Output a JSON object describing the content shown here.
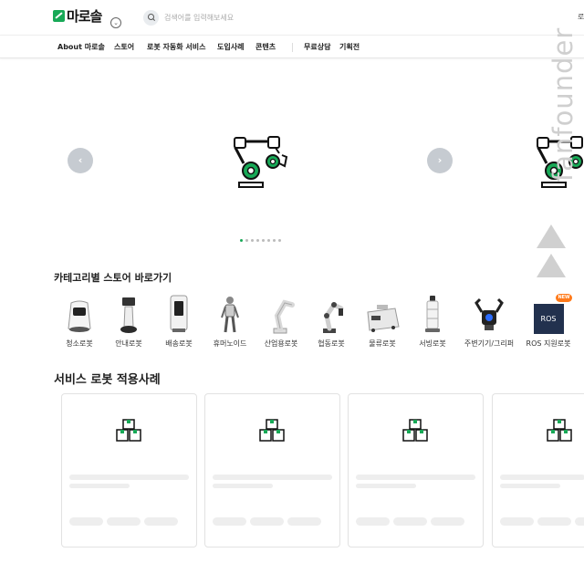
{
  "header": {
    "logo_text": "마로솔",
    "search_placeholder": "검색어를 입력해보세요",
    "right_text": "로"
  },
  "nav": {
    "items": [
      "About 마로솔",
      "스토어",
      "로봇 자동화 서비스",
      "도입사례",
      "콘텐츠",
      "무료상담",
      "기획전"
    ]
  },
  "hero": {
    "prev_icon": "chevron-left-icon",
    "next_icon": "chevron-right-icon",
    "slide_count": 8,
    "active_slide": 1
  },
  "watermark": {
    "text": "fanfounder"
  },
  "categories": {
    "title": "카테고리별 스토어 바로가기",
    "items": [
      "청소로봇",
      "안내로봇",
      "배송로봇",
      "휴머노이드",
      "산업용로봇",
      "협동로봇",
      "물류로봇",
      "서빙로봇",
      "주변기기/그리퍼",
      "ROS 지원로봇"
    ],
    "new_badge": "NEW",
    "ros_label": "ROS"
  },
  "cases": {
    "title": "서비스 로봇 적용사례",
    "card_count": 4
  },
  "colors": {
    "accent": "#18a957",
    "arrow_bg": "#c6cbd1",
    "badge": "#ff7a1a"
  }
}
